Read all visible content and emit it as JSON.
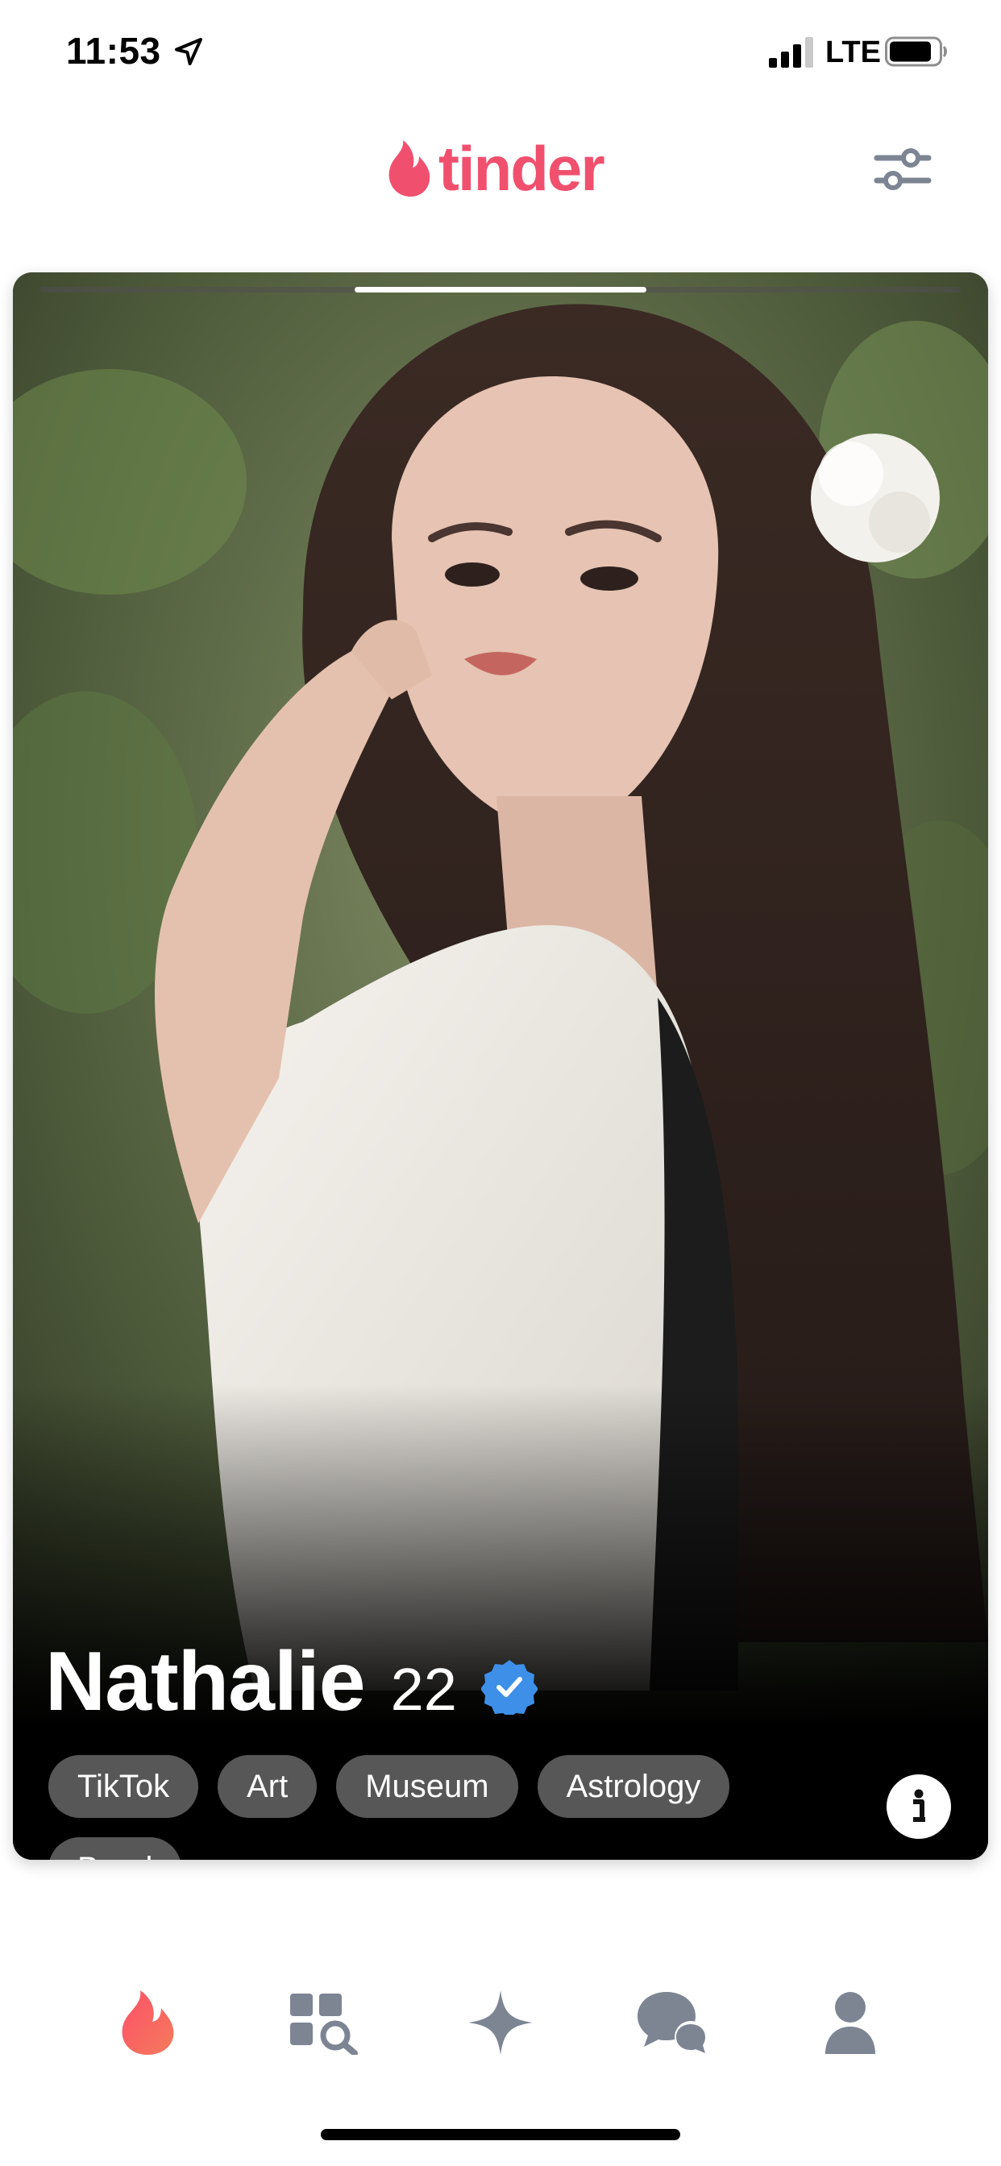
{
  "status_bar": {
    "time": "11:53",
    "network": "LTE",
    "signal_bars": 3,
    "battery_level": 0.85
  },
  "header": {
    "logo_text": "tinder",
    "brand_color": "#f0506e"
  },
  "card": {
    "photo_count": 3,
    "active_photo_index": 1,
    "name": "Nathalie",
    "age": "22",
    "verified": true,
    "tags": [
      "TikTok",
      "Art",
      "Museum",
      "Astrology",
      "Band"
    ]
  },
  "actions": {
    "rewind": {
      "icon": "rewind-icon",
      "color": "#e6c35a"
    },
    "nope": {
      "icon": "close-icon",
      "color": "#e24c4c"
    },
    "super_like": {
      "icon": "star-icon",
      "color": "#3d7ee8"
    },
    "like": {
      "icon": "heart-icon",
      "color": "#39c48d"
    },
    "boost": {
      "icon": "lightning-icon",
      "color": "#8b3fd8"
    }
  },
  "bottom_nav": {
    "items": [
      {
        "icon": "flame-icon",
        "active": true
      },
      {
        "icon": "explore-icon",
        "active": false
      },
      {
        "icon": "sparkle-icon",
        "active": false
      },
      {
        "icon": "chat-icon",
        "active": false
      },
      {
        "icon": "profile-icon",
        "active": false
      }
    ]
  }
}
